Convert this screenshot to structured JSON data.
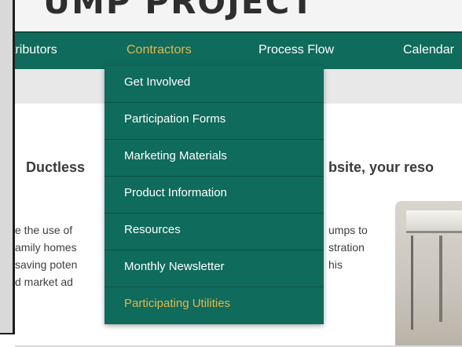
{
  "banner": {
    "title": "UMP PROJECT"
  },
  "nav": {
    "items": [
      {
        "label": "tributors"
      },
      {
        "label": "Contractors"
      },
      {
        "label": "Process Flow"
      },
      {
        "label": "Calendar"
      }
    ]
  },
  "dropdown": {
    "items": [
      {
        "label": "Get Involved"
      },
      {
        "label": "Participation Forms"
      },
      {
        "label": "Marketing Materials"
      },
      {
        "label": "Product Information"
      },
      {
        "label": "Resources"
      },
      {
        "label": "Monthly Newsletter"
      },
      {
        "label": "Participating Utilities"
      }
    ]
  },
  "content": {
    "heading_left": "Ductless",
    "heading_right": "bsite, your reso",
    "body_left": [
      "e the use of",
      "amily homes",
      "saving poten",
      "d market ad"
    ],
    "body_right": [
      "umps to",
      "stration",
      "his"
    ]
  },
  "colors": {
    "nav_green": "#0f6b5b",
    "active_gold": "#e5b64b"
  }
}
